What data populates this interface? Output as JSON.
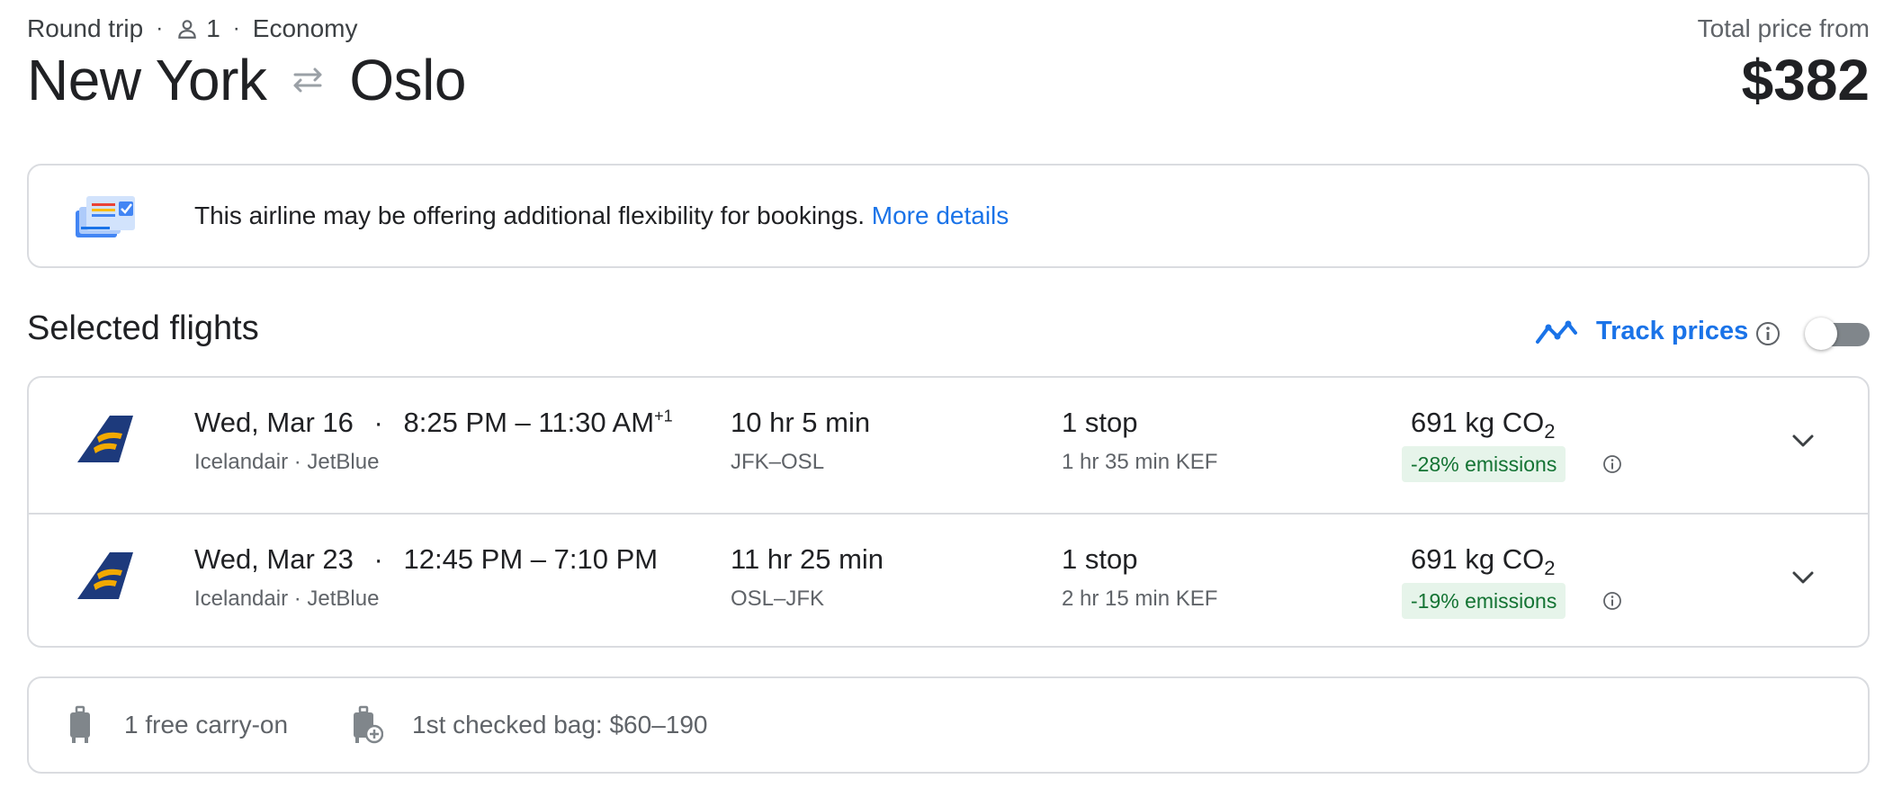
{
  "header": {
    "trip_type": "Round trip",
    "separator": "·",
    "passengers": "1",
    "cabin": "Economy",
    "origin": "New York",
    "destination": "Oslo",
    "price_label": "Total price from",
    "price": "$382"
  },
  "notice": {
    "text": "This airline may be offering additional flexibility for bookings.",
    "link_label": "More details"
  },
  "selected": {
    "title": "Selected flights",
    "track_label": "Track prices",
    "track_enabled": false
  },
  "flights": [
    {
      "date": "Wed, Mar 16",
      "times": "8:25 PM – 11:30 AM",
      "day_offset": "+1",
      "airlines": "Icelandair · JetBlue",
      "duration": "10 hr 5 min",
      "airports": "JFK–OSL",
      "stops": "1 stop",
      "layover": "1 hr 35 min KEF",
      "co2_value": "691 kg CO",
      "co2_sub": "2",
      "emissions": "-28% emissions"
    },
    {
      "date": "Wed, Mar 23",
      "times": "12:45 PM – 7:10 PM",
      "day_offset": "",
      "airlines": "Icelandair · JetBlue",
      "duration": "11 hr 25 min",
      "airports": "OSL–JFK",
      "stops": "1 stop",
      "layover": "2 hr 15 min KEF",
      "co2_value": "691 kg CO",
      "co2_sub": "2",
      "emissions": "-19% emissions"
    }
  ],
  "baggage": {
    "carry_on": "1 free carry-on",
    "checked": "1st checked bag: $60–190"
  },
  "colors": {
    "accent": "#1a73e8",
    "emissions_bg": "#e6f4ea",
    "emissions_text": "#137333",
    "border": "#dadce0",
    "logo_blue": "#1d3a7c",
    "logo_gold": "#f2a900"
  }
}
